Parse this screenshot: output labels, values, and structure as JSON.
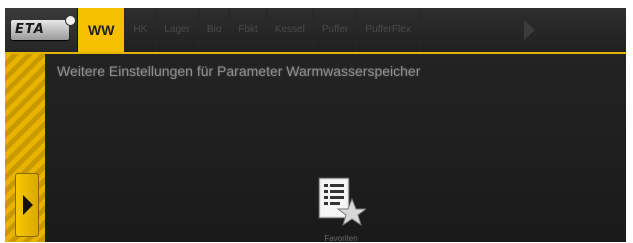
{
  "header": {
    "logo_text": "ETA",
    "tabs": [
      {
        "label": "WW",
        "active": true
      },
      {
        "label": "HK",
        "active": false
      },
      {
        "label": "Lager",
        "active": false
      },
      {
        "label": "Bio",
        "active": false
      },
      {
        "label": "Fbkt",
        "active": false
      },
      {
        "label": "Kessel",
        "active": false
      },
      {
        "label": "Puffer",
        "active": false
      },
      {
        "label": "PufferFlex",
        "active": false
      }
    ],
    "next_icon": "chevron-right-icon"
  },
  "content": {
    "title": "Weitere Einstellungen für Parameter Warmwasserspeicher",
    "favorites_icon": "document-star-icon",
    "favorites_label": "Favoriten"
  },
  "sidebar": {
    "expand_icon": "chevron-right-icon"
  },
  "colors": {
    "accent": "#f6c000",
    "background": "#1b1b1b",
    "stripe_dark": "#c89900"
  }
}
